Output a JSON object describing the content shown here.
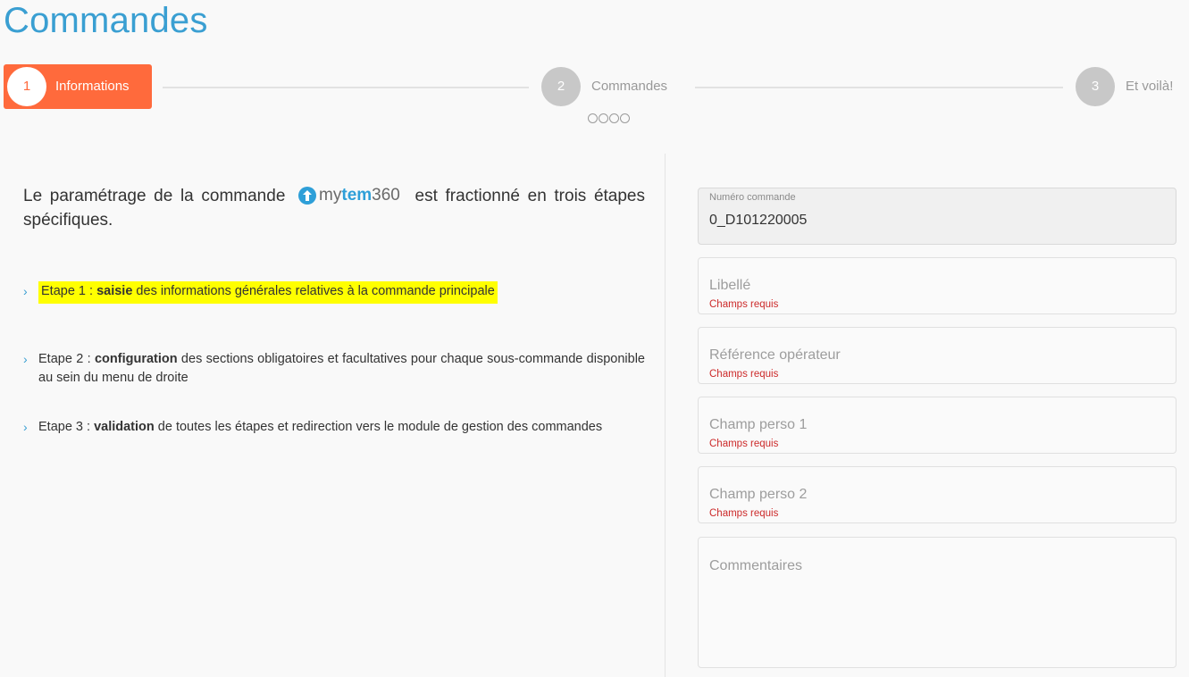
{
  "page": {
    "title": "Commandes"
  },
  "stepper": {
    "steps": [
      {
        "number": "1",
        "label": "Informations",
        "state": "active"
      },
      {
        "number": "2",
        "label": "Commandes",
        "state": "inactive"
      },
      {
        "number": "3",
        "label": "Et voilà!",
        "state": "inactive"
      }
    ],
    "substep_count": 4,
    "colors": {
      "active": "#ff6a3c",
      "inactive": "#c8c8c8"
    }
  },
  "intro": {
    "before_logo": "Le paramétrage de la commande",
    "after_logo": "est fractionné en trois étapes spécifiques.",
    "logo": {
      "part1": "my",
      "part2": "tem",
      "part3": "360",
      "icon": "mytem360-logo-icon",
      "brand_color": "#2e9fd8"
    }
  },
  "steps_description": [
    {
      "prefix": "Etape 1 : ",
      "keyword": "saisie",
      "suffix": " des informations générales relatives à la commande principale",
      "highlighted": true
    },
    {
      "prefix": "Etape 2 : ",
      "keyword": "configuration",
      "suffix": " des sections obligatoires et facultatives pour chaque sous-commande disponible au sein du menu de droite",
      "highlighted": false
    },
    {
      "prefix": "Etape 3 : ",
      "keyword": "validation",
      "suffix": " de toutes les étapes et redirection vers le module de gestion des commandes",
      "highlighted": false
    }
  ],
  "form": {
    "numero_commande": {
      "label": "Numéro commande",
      "value": "0_D101220005"
    },
    "libelle": {
      "placeholder": "Libellé",
      "error": "Champs requis"
    },
    "reference_operateur": {
      "placeholder": "Référence opérateur",
      "error": "Champs requis"
    },
    "champ_perso_1": {
      "placeholder": "Champ perso 1",
      "error": "Champs requis"
    },
    "champ_perso_2": {
      "placeholder": "Champ perso 2",
      "error": "Champs requis"
    },
    "commentaires": {
      "placeholder": "Commentaires"
    }
  }
}
